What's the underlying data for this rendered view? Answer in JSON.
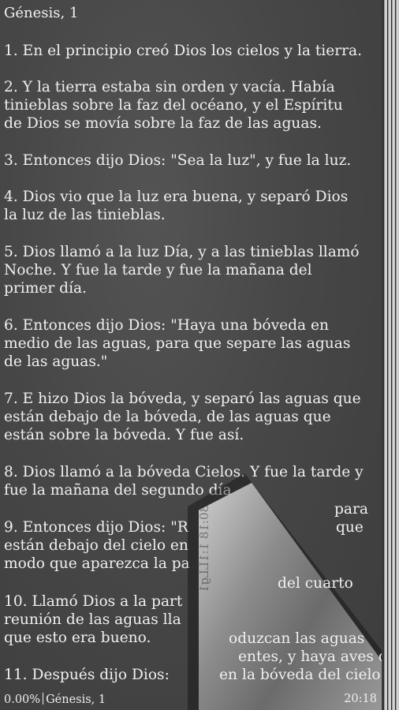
{
  "header": {
    "title": "Génesis, 1"
  },
  "verses": [
    {
      "lines": [
        "1. En el principio creó Dios los cielos y la tierra."
      ]
    },
    {
      "lines": [
        "2. Y la tierra estaba sin orden y vacía. Había",
        "tinieblas sobre la faz del océano, y el Espíritu",
        "de Dios se movía sobre la faz de las aguas."
      ]
    },
    {
      "lines": [
        "3. Entonces dijo Dios: \"Sea la luz\", y fue la luz."
      ]
    },
    {
      "lines": [
        "4. Dios vio que la luz era buena, y separó Dios",
        "la luz de las tinieblas."
      ]
    },
    {
      "lines": [
        "5. Dios llamó a la luz Día, y a las tinieblas llamó",
        "Noche. Y fue la tarde y fue la mañana del",
        "primer día."
      ]
    },
    {
      "lines": [
        "6. Entonces dijo Dios: \"Haya una bóveda en",
        "medio de las aguas, para que separe las aguas",
        "de las aguas.\""
      ]
    },
    {
      "lines": [
        "7. E hizo Dios la bóveda, y separó las aguas que",
        "están debajo de la bóveda, de las aguas que",
        "están sobre la bóveda. Y fue así."
      ]
    },
    {
      "lines": [
        "8. Dios llamó a la bóveda Cielos. Y fue la tarde y",
        "fue la mañana del segundo día."
      ]
    }
  ],
  "partial": {
    "v9": [
      "9. Entonces dijo Dios: \"R",
      "están debajo del cielo en",
      "modo que aparezca la pa"
    ],
    "v10": [
      "10. Llamó Dios a la part",
      "reunión de las aguas lla",
      "que esto era bueno."
    ],
    "v11": "11. Después dijo Dios:",
    "r1": "para",
    "r2": "que",
    "r3": "del cuarto",
    "r4": "oduzcan las aguas",
    "r5": "entes, y haya aves que",
    "r6": "en la bóveda del cielo.\""
  },
  "curl_text": "30:18  1:1LLg1",
  "footer": {
    "progress": "0.00%",
    "book": "Génesis, 1",
    "time": "20:18"
  }
}
